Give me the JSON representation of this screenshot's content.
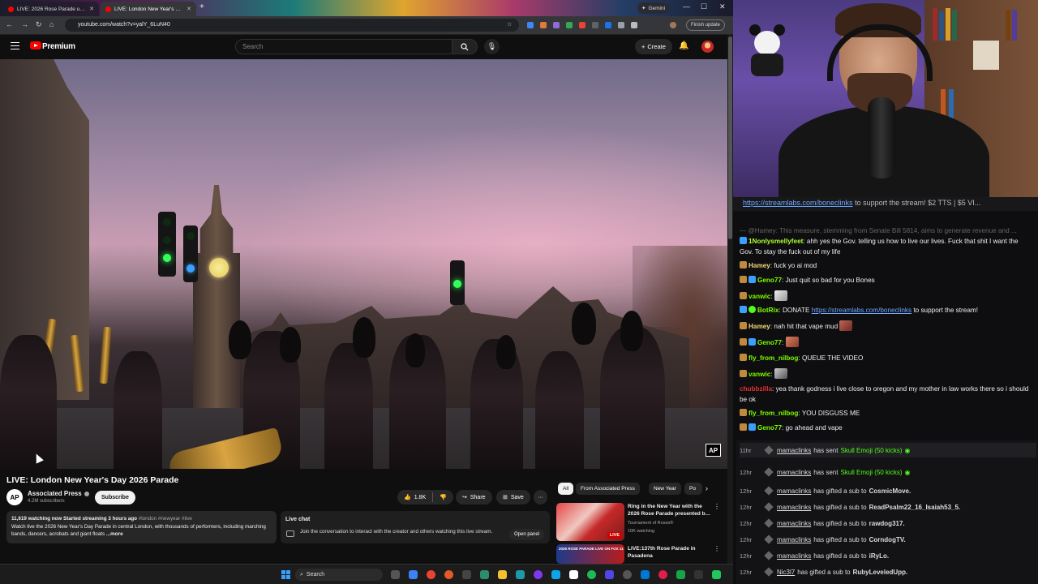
{
  "browser": {
    "tabs": [
      {
        "title": "LIVE: 2026 Rose Parade under",
        "active": false
      },
      {
        "title": "LIVE: London New Year's Day 2",
        "active": true
      }
    ],
    "gemini_label": "Gemini",
    "url": "youtube.com/watch?v=yalY_6LuN40",
    "finish_update": "Finish update"
  },
  "youtube": {
    "brand": "Premium",
    "search_placeholder": "Search",
    "create_label": "Create"
  },
  "video": {
    "title": "LIVE: London New Year's Day 2026 Parade",
    "watermark": "AP",
    "channel": {
      "avatar_text": "AP",
      "name": "Associated Press",
      "subscribers": "4.2M subscribers",
      "subscribe_label": "Subscribe"
    },
    "actions": {
      "likes": "1.8K",
      "share": "Share",
      "save": "Save"
    },
    "description": {
      "meta": "11,619 watching now  Started streaming 3 hours ago",
      "tags": " #london #newyear #live",
      "text": "Watch live the 2026 New Year's Day Parade in central London, with thousands of performers, including marching bands, dancers, acrobats and giant floats ",
      "more": "...more"
    },
    "live_chat": {
      "title": "Live chat",
      "text": "Join the conversation to interact with the creator and others watching this live stream.",
      "button": "Open panel"
    }
  },
  "recommendations": {
    "chips": [
      "All",
      "From Associated Press",
      "New Year",
      "Po"
    ],
    "items": [
      {
        "title": "Ring in the New Year with the 2026 Rose Parade presented b…",
        "channel": "Tournament of Roses®",
        "meta": "10K watching",
        "badge": "LIVE"
      },
      {
        "title": "LIVE:137th Rose Parade in Pasadena",
        "thumb_text": "2026 ROSE PARADE LIVE ON FOX 11"
      }
    ]
  },
  "taskbar": {
    "search": "Search"
  },
  "chat": {
    "pinned_link": "https://streamlabs.com/boneclinks",
    "pinned_text": " to support the stream! $2 TTS | $5 VI...",
    "faded": "— @Hamey: This measure, stemming from Senate Bill 5814, aims to generate revenue and ...",
    "messages": [
      {
        "user": "1Nonlysmellyfeet",
        "color": "#adff2f",
        "text": ": ahh yes the Gov. telling us how to live our lives. Fuck that shit I want the Gov. To stay the fuck out of my life"
      },
      {
        "user": "Hamey",
        "color": "#f7d774",
        "text": ": fuck yo ai mod"
      },
      {
        "user": "Geno77",
        "color": "#7cfc00",
        "text": ": Just quit so bad for you Bones"
      },
      {
        "user": "vanwic",
        "color": "#7cfc00",
        "text": ":"
      },
      {
        "user": "BotRix",
        "color": "#7cfc00",
        "text": ": DONATE ",
        "link": "https://streamlabs.com/boneclinks",
        "after": " to support the stream!"
      },
      {
        "user": "Hamey",
        "color": "#f7d774",
        "text": ": nah hit that vape mud"
      },
      {
        "user": "Geno77",
        "color": "#7cfc00",
        "text": ":"
      },
      {
        "user": "fly_from_nilbog",
        "color": "#7cfc00",
        "text": ": QUEUE THE VIDEO"
      },
      {
        "user": "vanwic",
        "color": "#7cfc00",
        "text": ":"
      },
      {
        "user": "chubbzilla",
        "color": "#e03030",
        "text": ": yea thank godness i live close to oregon and my mother in law works there so i should be ok"
      },
      {
        "user": "fly_from_nilbog",
        "color": "#7cfc00",
        "text": ": YOU DISGUSS ME"
      },
      {
        "user": "Geno77",
        "color": "#7cfc00",
        "text": ": go ahead and vape"
      }
    ],
    "events": [
      {
        "time": "11hr",
        "user": "mamaclinks",
        "action": "has sent",
        "item": "Skull Emoji (50 kicks)",
        "type": "kicks"
      },
      {
        "time": "12hr",
        "user": "mamaclinks",
        "action": "has sent",
        "item": "Skull Emoji (50 kicks)",
        "type": "kicks"
      },
      {
        "time": "12hr",
        "user": "mamaclinks",
        "action": "has gifted a sub to",
        "item": "CosmicMove.",
        "type": "sub"
      },
      {
        "time": "12hr",
        "user": "mamaclinks",
        "action": "has gifted a sub to",
        "item": "ReadPsalm22_16_Isaiah53_5.",
        "type": "sub"
      },
      {
        "time": "12hr",
        "user": "mamaclinks",
        "action": "has gifted a sub to",
        "item": "rawdog317.",
        "type": "sub"
      },
      {
        "time": "12hr",
        "user": "mamaclinks",
        "action": "has gifted a sub to",
        "item": "CorndogTV.",
        "type": "sub"
      },
      {
        "time": "12hr",
        "user": "mamaclinks",
        "action": "has gifted a sub to",
        "item": "iRyLo.",
        "type": "sub"
      },
      {
        "time": "12hr",
        "user": "Nic3l7",
        "action": "has gifted a sub to",
        "item": "RubyLeveledUpp.",
        "type": "sub"
      }
    ]
  },
  "colors": {
    "youtube_red": "#ff0000",
    "kick_green": "#53fc18",
    "link_blue": "#6fa8ff"
  }
}
